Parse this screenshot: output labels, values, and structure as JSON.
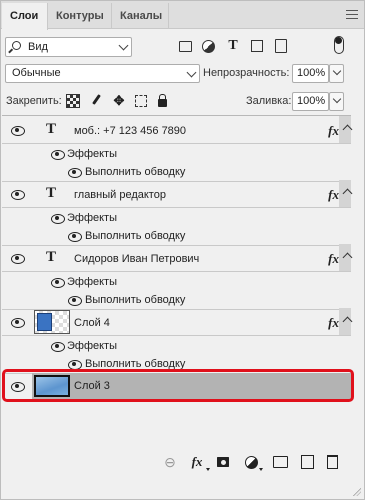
{
  "tabs": [
    {
      "label": "Слои"
    },
    {
      "label": "Контуры"
    },
    {
      "label": "Каналы"
    }
  ],
  "filter": {
    "kind_label": "Вид"
  },
  "blend": {
    "mode": "Обычные",
    "opacity_label": "Непрозрачность:",
    "opacity_value": "100%"
  },
  "lock": {
    "label": "Закрепить:",
    "fill_label": "Заливка:",
    "fill_value": "100%"
  },
  "layers": [
    {
      "name": "моб.: +7 123 456 7890",
      "effects_label": "Эффекты",
      "stroke_label": "Выполнить обводку"
    },
    {
      "name": "главный редактор",
      "effects_label": "Эффекты",
      "stroke_label": "Выполнить обводку"
    },
    {
      "name": "Сидоров Иван Петрович",
      "effects_label": "Эффекты",
      "stroke_label": "Выполнить обводку"
    },
    {
      "name": "Слой 4",
      "effects_label": "Эффекты",
      "stroke_label": "Выполнить обводку"
    },
    {
      "name": "Слой 3"
    }
  ],
  "glyphs": {
    "type_tool": "T",
    "fx": "fx",
    "move": "✥",
    "link": "⊖"
  },
  "colors": {
    "selection_highlight": "#e0101b",
    "selected_row": "#b3b3b3"
  }
}
